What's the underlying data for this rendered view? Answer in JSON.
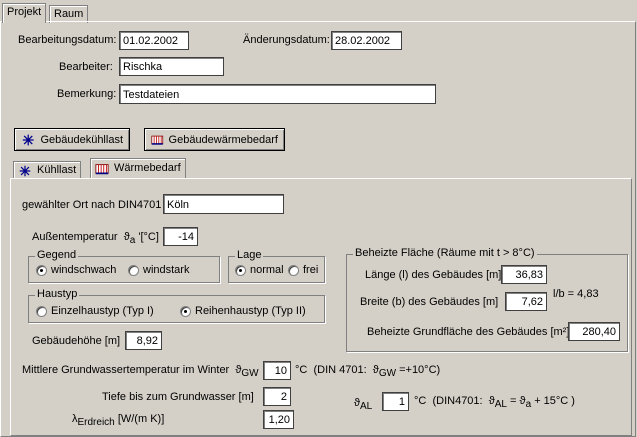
{
  "tabs": {
    "projekt": "Projekt",
    "raum": "Raum"
  },
  "header": {
    "bearbeitungsdatum_label": "Bearbeitungsdatum:",
    "bearbeitungsdatum": "01.02.2002",
    "aenderungsdatum_label": "Änderungsdatum:",
    "aenderungsdatum": "28.02.2002",
    "bearbeiter_label": "Bearbeiter:",
    "bearbeiter": "Rischka",
    "bemerkung_label": "Bemerkung:",
    "bemerkung": "Testdateien"
  },
  "buttons": {
    "kuehllast": "Gebäudekühllast",
    "waermebedarf": "Gebäudewärmebedarf"
  },
  "subtabs": {
    "kuehllast": "Kühllast",
    "waermebedarf": "Wärmebedarf"
  },
  "form": {
    "ort_label": "gewählter Ort nach DIN4701",
    "ort": "Köln",
    "aussentemp_label": "Außentemperatur",
    "aussentemp_unit": "'[°C]",
    "theta_sym": "ϑ",
    "theta_sub_a": "a",
    "aussentemp": "-14",
    "gegend_title": "Gegend",
    "gegend_windschwach": "windschwach",
    "gegend_windstark": "windstark",
    "lage_title": "Lage",
    "lage_normal": "normal",
    "lage_frei": "frei",
    "haustyp_title": "Haustyp",
    "haustyp_einzel": "Einzelhaustyp (Typ I)",
    "haustyp_reihen": "Reihenhaustyp (Typ II)",
    "hoehe_label": "Gebäudehöhe [m]",
    "hoehe": "8,92",
    "beheizt_title": "Beheizte Fläche   (Räume mit t > 8°C)",
    "laenge_label": "Länge (l) des Gebäudes [m]",
    "laenge": "36,83",
    "breite_label": "Breite (b) des Gebäudes [m]",
    "breite": "7,62",
    "ratio": "l/b = 4,83",
    "grundflaeche_label": "Beheizte Grundfläche des Gebäudes [m²]",
    "grundflaeche": "280,40",
    "gw_label": "Mittlere Grundwassertemperatur im Winter",
    "gw_sub": "GW",
    "gw_value": "10",
    "gw_unit": "°C",
    "gw_din_prefix": "(DIN 4701:",
    "gw_din_suffix": "=+10°C)",
    "tiefe_label": "Tiefe bis zum Grundwasser [m]",
    "tiefe": "2",
    "lambda_sym": "λ",
    "lambda_sub": "Erdreich",
    "lambda_unit": "[W/(m K)]",
    "lambda": "1,20",
    "al_sub": "AL",
    "al_value": "1",
    "al_unit": "°C",
    "al_din_prefix": "(DIN4701:",
    "al_din_mid": "=",
    "al_din_suffix": "+ 15°C )"
  }
}
